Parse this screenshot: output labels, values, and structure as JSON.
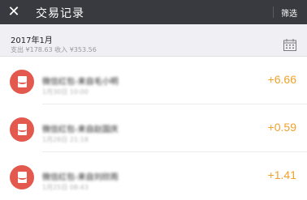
{
  "header": {
    "close_glyph": "✕",
    "title": "交易记录",
    "filter_label": "筛选",
    "background": "#393a3f"
  },
  "month": {
    "label": "2017年1月",
    "summary": "支出 ¥178.63 收入 ¥353.56"
  },
  "transactions": [
    {
      "title": "微信红包-来自毛小明",
      "time": "1月30日 10:00",
      "amount": "+6.66",
      "icon": "red-packet-icon"
    },
    {
      "title": "微信红包-来自赵国庆",
      "time": "1月28日 21:18",
      "amount": "+0.59",
      "icon": "red-packet-icon"
    },
    {
      "title": "微信红包-来自刘欣雨",
      "time": "1月25日 08:43",
      "amount": "+1.41",
      "icon": "red-packet-icon"
    }
  ],
  "colors": {
    "amount": "#f0a12a",
    "red_packet": "#e4594d"
  }
}
